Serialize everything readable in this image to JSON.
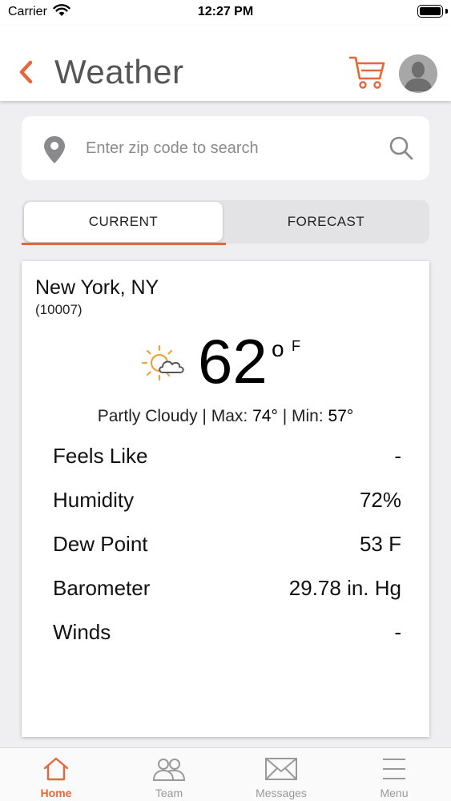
{
  "status_bar": {
    "carrier": "Carrier",
    "time": "12:27 PM"
  },
  "header": {
    "title": "Weather",
    "icons": [
      "back-chevron-icon",
      "cart-icon",
      "avatar-icon"
    ]
  },
  "search": {
    "placeholder": "Enter zip code to search",
    "value": ""
  },
  "tabs": [
    {
      "label": "CURRENT",
      "selected": true
    },
    {
      "label": "FORECAST",
      "selected": false
    }
  ],
  "weather": {
    "city": "New York, NY",
    "zip": "(10007)",
    "icon": "partly-cloudy-icon",
    "temperature": "62",
    "unit_degree": "o",
    "unit": "F",
    "condition": "Partly Cloudy",
    "max_label": "Max:",
    "max": "74°",
    "min_label": "Min:",
    "min": "57°",
    "separator": "|"
  },
  "details": [
    {
      "label": "Feels Like",
      "value": "-"
    },
    {
      "label": "Humidity",
      "value": "72%"
    },
    {
      "label": "Dew Point",
      "value": "53 F"
    },
    {
      "label": "Barometer",
      "value": "29.78 in. Hg"
    },
    {
      "label": "Winds",
      "value": "-"
    }
  ],
  "bottom_nav": [
    {
      "label": "Home",
      "icon": "home-icon",
      "active": true
    },
    {
      "label": "Team",
      "icon": "team-icon",
      "active": false
    },
    {
      "label": "Messages",
      "icon": "envelope-icon",
      "active": false
    },
    {
      "label": "Menu",
      "icon": "hamburger-menu-icon",
      "active": false
    }
  ],
  "colors": {
    "accent": "#e5673a",
    "background": "#efeff1",
    "inactive": "#999999"
  }
}
